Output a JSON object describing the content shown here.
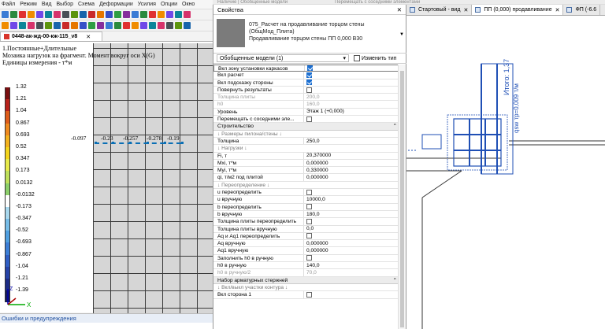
{
  "left_app": {
    "menu": [
      "Файл",
      "Режим",
      "Вид",
      "Выбор",
      "Схема",
      "Деформации",
      "Усилия",
      "Опции",
      "Окно"
    ],
    "doc_tab": "0448-ак-жд-00-кж-115_v8",
    "canvas_header": [
      "1.Постоянные+Длительные",
      "Мозаика нагрузок на фрагмент. Момент вокруг оси X(G)",
      "Единицы измерения - т*м"
    ],
    "legend": [
      {
        "value": "1.32",
        "color": "#7a0f10"
      },
      {
        "value": "1.21",
        "color": "#b8221b"
      },
      {
        "value": "1.04",
        "color": "#de5c1a"
      },
      {
        "value": "0.867",
        "color": "#ef8a1f"
      },
      {
        "value": "0.693",
        "color": "#f3b21e"
      },
      {
        "value": "0.52",
        "color": "#f3d41c"
      },
      {
        "value": "0.347",
        "color": "#e7ea4a"
      },
      {
        "value": "0.173",
        "color": "#bfe05a"
      },
      {
        "value": "0.0132",
        "color": "#8ccf6a"
      },
      {
        "value": "-0.0132",
        "color": "#ffffff"
      },
      {
        "value": "-0.173",
        "color": "#a8d8ee"
      },
      {
        "value": "-0.347",
        "color": "#77bde8"
      },
      {
        "value": "-0.52",
        "color": "#4f9fe0"
      },
      {
        "value": "-0.693",
        "color": "#3c7ed6"
      },
      {
        "value": "-0.867",
        "color": "#2f5ec4"
      },
      {
        "value": "-1.04",
        "color": "#2643a8"
      },
      {
        "value": "-1.21",
        "color": "#1c2c86"
      },
      {
        "value": "-1.39",
        "color": "#141a5c"
      }
    ],
    "values_row": [
      "-0.097",
      "-0.23",
      "-0.257",
      "-0.278",
      "-0.19"
    ],
    "axis": {
      "x": "X",
      "y": "Y",
      "z": "Z"
    },
    "error_panel": "Ошибки и предупреждения"
  },
  "top_strip": [
    "Наличие | Обобщенные модели",
    "Перемещать с соседними элементами"
  ],
  "properties": {
    "title": "Свойства",
    "type_name": [
      "075_Расчет на продавливание торцом стены",
      "(ОбщМод_Плита)",
      "Продавливание торцом стены ПП 0,000 В30"
    ],
    "filter": "Обобщенные модели (1)",
    "edit_type": "Изменить тип",
    "rows": [
      {
        "k": "Вкл зону установки каркасов",
        "type": "cb",
        "on": true,
        "hilite": true
      },
      {
        "k": "Вкл расчет",
        "type": "cb",
        "on": true
      },
      {
        "k": "Вкл подсказку стороны",
        "type": "cb",
        "on": true
      },
      {
        "k": "Повернуть результаты",
        "type": "cb",
        "on": false
      },
      {
        "k": "Толщина плиты",
        "type": "text",
        "v": "200,0",
        "dim": true
      },
      {
        "k": "h0",
        "type": "text",
        "v": "160,0",
        "dim": true
      },
      {
        "k": "Уровень",
        "type": "text",
        "v": "Этаж 1 (+0,000)"
      },
      {
        "k": "Перемещать с соседними эле...",
        "type": "cb",
        "on": false
      },
      {
        "k": "Строительство",
        "type": "section"
      },
      {
        "k": "↓ Размеры пилона/стены ↓",
        "type": "group"
      },
      {
        "k": "Толщина",
        "type": "text",
        "v": "250,0"
      },
      {
        "k": "↓ Нагрузки ↓",
        "type": "group"
      },
      {
        "k": "Fi, т",
        "type": "text",
        "v": "20,370000"
      },
      {
        "k": "Mxi, т*м",
        "type": "text",
        "v": "0,000000"
      },
      {
        "k": "Myi, т*м",
        "type": "text",
        "v": "0,330000"
      },
      {
        "k": "qi, т/м2 под плитой",
        "type": "text",
        "v": "0,000000"
      },
      {
        "k": "↓ Переопределение ↓",
        "type": "group"
      },
      {
        "k": "u переопределить",
        "type": "cb",
        "on": false
      },
      {
        "k": "u вручную",
        "type": "text",
        "v": "10000,0"
      },
      {
        "k": "b переопределить",
        "type": "cb",
        "on": false
      },
      {
        "k": "b вручную",
        "type": "text",
        "v": "180,0"
      },
      {
        "k": "Толщина плиты переопределить",
        "type": "cb",
        "on": false
      },
      {
        "k": "Толщина плиты вручную",
        "type": "text",
        "v": "0,0"
      },
      {
        "k": "Aq и Aq1 переопределить",
        "type": "cb",
        "on": false
      },
      {
        "k": "Aq вручную",
        "type": "text",
        "v": "0,000000"
      },
      {
        "k": "Aq1 вручную",
        "type": "text",
        "v": "0,000000"
      },
      {
        "k": "Заполнить h0 в ручную",
        "type": "cb",
        "on": false
      },
      {
        "k": "h0 в ручную",
        "type": "text",
        "v": "140,0"
      },
      {
        "k": "h0 в ручную/2",
        "type": "text",
        "v": "70,0",
        "dim": true
      },
      {
        "k": "Набор арматурных стержней",
        "type": "section"
      },
      {
        "k": "↓ Вкл/выкл участки контура ↓",
        "type": "group"
      },
      {
        "k": "Вкл сторона 1",
        "type": "cb",
        "on": false
      }
    ]
  },
  "view_tabs": [
    {
      "label": "Стартовый - вид",
      "active": false
    },
    {
      "label": "ПП (0,000) продавливание",
      "active": true
    },
    {
      "label": "ФП (-6.6",
      "active": false
    }
  ],
  "cad_labels": [
    "Итого: 1,37",
    "qsw тр=0,009 т/м"
  ]
}
